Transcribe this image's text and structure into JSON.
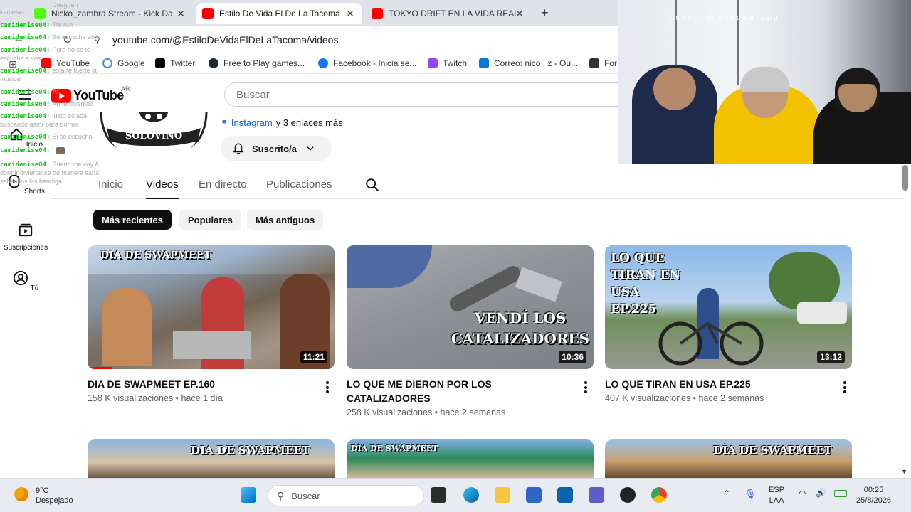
{
  "browser": {
    "tabs": [
      {
        "title": "Nicko_zambra Stream - Kick Da",
        "icon": "kick-icon"
      },
      {
        "title": "Estilo De Vida El De La Tacoma",
        "icon": "youtube-icon",
        "active": true
      },
      {
        "title": "TOKYO DRIFT EN LA VIDA REAL",
        "icon": "youtube-icon"
      }
    ],
    "url": "youtube.com/@EstiloDeVidaElDeLaTacoma/videos",
    "bookmarks": [
      {
        "label": "YouTube",
        "color": "#ff0000"
      },
      {
        "label": "Google",
        "color": "#4285f4"
      },
      {
        "label": "Twitter",
        "color": "#000000"
      },
      {
        "label": "Free to Play games...",
        "color": "#1b2838"
      },
      {
        "label": "Facebook - Inicia se...",
        "color": "#1877f2"
      },
      {
        "label": "Twitch",
        "color": "#9146ff"
      },
      {
        "label": "Correo: nico . z - Ou...",
        "color": "#0078d4"
      },
      {
        "label": "For",
        "color": "#333333"
      }
    ]
  },
  "youtube": {
    "logo_text": "YouTube",
    "country": "AR",
    "search_placeholder": "Buscar",
    "nav": [
      {
        "label": "Inicio",
        "icon": "home-icon"
      },
      {
        "label": "Shorts",
        "icon": "shorts-icon"
      },
      {
        "label": "Suscripciones",
        "icon": "subscriptions-icon"
      },
      {
        "label": "Tú",
        "icon": "user-icon"
      }
    ],
    "channel": {
      "avatar_text": "SOLOVINO",
      "link_label": "Instagram",
      "more_links": "y 3 enlaces más",
      "subscribe_label": "Suscrito/a"
    },
    "tabs": [
      "Inicio",
      "Videos",
      "En directo",
      "Publicaciones"
    ],
    "active_tab": "Videos",
    "chips": [
      "Más recientes",
      "Populares",
      "Más antiguos"
    ],
    "videos": [
      {
        "title": "DIA DE SWAPMEET EP.160",
        "meta": "158 K visualizaciones • hace 1 día",
        "duration": "11:21",
        "overlay": "DIA DE SWAPMEET"
      },
      {
        "title": "LO QUE ME DIERON POR LOS CATALIZADORES",
        "meta": "258 K visualizaciones • hace 2 semanas",
        "duration": "10:36",
        "overlay": "VENDÍ LOS CATALIZADORES"
      },
      {
        "title": "LO QUE TIRAN EN USA EP.225",
        "meta": "407 K visualizaciones • hace 2 semanas",
        "duration": "13:12",
        "overlay": "LO QUE TIRAN EN USA EP.225"
      }
    ],
    "row2_overlays": [
      "DIA DE SWAPMEET",
      "DÍA DE SWAPMEET",
      "DÍA DE SWAPMEET"
    ]
  },
  "chat": [
    {
      "user": "",
      "msg": "Jueguen"
    },
    {
      "user": "",
      "msg": "kamelan"
    },
    {
      "user": "camidenise04:",
      "msg": "Tnt run"
    },
    {
      "user": "camidenise04:",
      "msg": "Se escucha en"
    },
    {
      "user": "camidenise04:",
      "msg": "Pero no se te"
    },
    {
      "user": "",
      "msg": "escucha a vos"
    },
    {
      "user": "camidenise04:",
      "msg": "esta re fuerte la"
    },
    {
      "user": "",
      "msg": "musica"
    },
    {
      "user": "camidenise04:",
      "msg": "Al"
    },
    {
      "user": "camidenise04:",
      "msg": "An te divertido"
    },
    {
      "user": "camidenise04:",
      "msg": "justo estaba"
    },
    {
      "user": "",
      "msg": "buscando asmr para dormir"
    },
    {
      "user": "camidenise04:",
      "msg": "Si se escucha"
    },
    {
      "user": "camidenise04:",
      "msg": ""
    },
    {
      "user": "camidenise04:",
      "msg": "Bueno me voy A"
    },
    {
      "user": "",
      "msg": "dormir diviertanse de manera sana"
    },
    {
      "user": "",
      "msg": "saben los los bendiga"
    }
  ],
  "webcam": {
    "watermark": "using droidcam.app"
  },
  "taskbar": {
    "weather_temp": "9°C",
    "weather_desc": "Despejado",
    "search_placeholder": "Buscar",
    "lang_top": "ESP",
    "lang_bottom": "LAA",
    "time": "00:25",
    "date": "25/8/2026"
  }
}
